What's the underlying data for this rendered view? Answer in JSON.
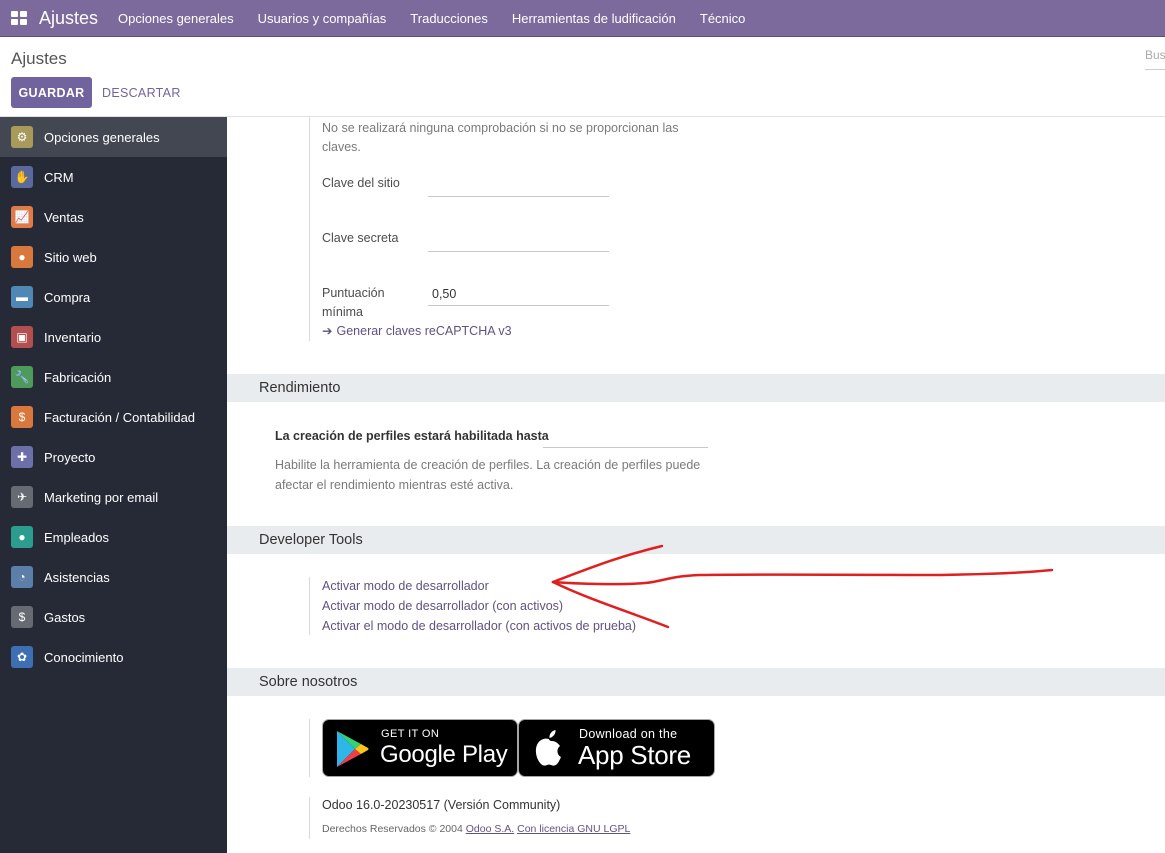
{
  "navbar": {
    "brand": "Ajustes",
    "menu": [
      "Opciones generales",
      "Usuarios y compañías",
      "Traducciones",
      "Herramientas de ludificación",
      "Técnico"
    ]
  },
  "control_panel": {
    "breadcrumb": "Ajustes",
    "search_placeholder": "Bus",
    "save_label": "GUARDAR",
    "discard_label": "DESCARTAR"
  },
  "sidebar": {
    "items": [
      {
        "label": "Opciones generales",
        "icon": "gear-icon",
        "color": "#a89a5b"
      },
      {
        "label": "CRM",
        "icon": "handshake-icon",
        "color": "#5b6a9d"
      },
      {
        "label": "Ventas",
        "icon": "chart-icon",
        "color": "#e07b48"
      },
      {
        "label": "Sitio web",
        "icon": "globe-icon",
        "color": "#d9783d"
      },
      {
        "label": "Compra",
        "icon": "card-icon",
        "color": "#4f88b5"
      },
      {
        "label": "Inventario",
        "icon": "box-icon",
        "color": "#b3504f"
      },
      {
        "label": "Fabricación",
        "icon": "wrench-icon",
        "color": "#4d9a5b"
      },
      {
        "label": "Facturación / Contabilidad",
        "icon": "invoice-icon",
        "color": "#d9783d"
      },
      {
        "label": "Proyecto",
        "icon": "puzzle-icon",
        "color": "#6c6fa8"
      },
      {
        "label": "Marketing por email",
        "icon": "paper-plane-icon",
        "color": "#666a72"
      },
      {
        "label": "Empleados",
        "icon": "people-icon",
        "color": "#2c9c8f"
      },
      {
        "label": "Asistencias",
        "icon": "user-clock-icon",
        "color": "#5b7fa8"
      },
      {
        "label": "Gastos",
        "icon": "user-dollar-icon",
        "color": "#666a72"
      },
      {
        "label": "Conocimiento",
        "icon": "brain-icon",
        "color": "#3f6fb3"
      }
    ]
  },
  "recaptcha": {
    "help": "No se realizará ninguna comprobación si no se proporcionan las claves.",
    "site_key_label": "Clave del sitio",
    "site_key_value": "",
    "secret_key_label": "Clave secreta",
    "secret_key_value": "",
    "min_score_label": "Puntuación mínima",
    "min_score_value": "0,50",
    "generate_link": "Generar claves reCAPTCHA v3"
  },
  "performance": {
    "title": "Rendimiento",
    "profiling_label": "La creación de perfiles estará habilitada hasta",
    "profiling_value": "",
    "profiling_help": "Habilite la herramienta de creación de perfiles. La creación de perfiles puede afectar el rendimiento mientras esté activa."
  },
  "developer_tools": {
    "title": "Developer Tools",
    "links": [
      "Activar modo de desarrollador",
      "Activar modo de desarrollador (con activos)",
      "Activar el modo de desarrollador (con activos de prueba)"
    ]
  },
  "about": {
    "title": "Sobre nosotros",
    "google_play_small": "GET IT ON",
    "google_play_big": "Google Play",
    "app_store_small": "Download on the",
    "app_store_big": "App Store",
    "version": "Odoo 16.0-20230517 (Versión Community)",
    "copyright_prefix": "Derechos Reservados © 2004",
    "company_link": "Odoo S.A.",
    "license_link": "Con licencia GNU LGPL"
  },
  "annotation_color": "#e02020"
}
